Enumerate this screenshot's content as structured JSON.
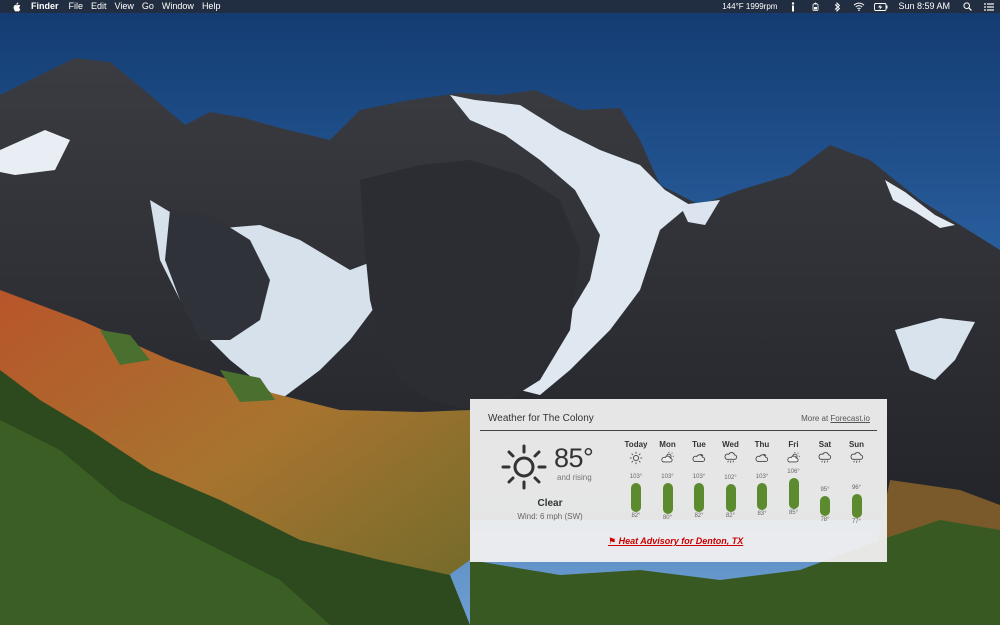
{
  "menubar": {
    "app_name": "Finder",
    "menus": [
      "File",
      "Edit",
      "View",
      "Go",
      "Window",
      "Help"
    ],
    "status_text": "144°F 1999rpm",
    "clock": "Sun 8:59 AM"
  },
  "widget": {
    "title": "Weather for The Colony",
    "more_prefix": "More at ",
    "more_link": "Forecast.io",
    "current": {
      "icon": "sun-icon",
      "temp": "85°",
      "trend": "and rising",
      "condition": "Clear",
      "wind": "Wind: 6 mph (SW)"
    },
    "forecast": [
      {
        "day": "Today",
        "icon": "sun-icon",
        "high": "103°",
        "low": "82°",
        "hi": 103,
        "lo": 82
      },
      {
        "day": "Mon",
        "icon": "partly-cloudy-icon",
        "high": "103°",
        "low": "80°",
        "hi": 103,
        "lo": 80
      },
      {
        "day": "Tue",
        "icon": "cloudy-icon",
        "high": "103°",
        "low": "82°",
        "hi": 103,
        "lo": 82
      },
      {
        "day": "Wed",
        "icon": "rain-icon",
        "high": "102°",
        "low": "82°",
        "hi": 102,
        "lo": 82
      },
      {
        "day": "Thu",
        "icon": "cloudy-icon",
        "high": "103°",
        "low": "83°",
        "hi": 103,
        "lo": 83
      },
      {
        "day": "Fri",
        "icon": "partly-cloudy-icon",
        "high": "106°",
        "low": "85°",
        "hi": 106,
        "lo": 85
      },
      {
        "day": "Sat",
        "icon": "rain-icon",
        "high": "95°",
        "low": "78°",
        "hi": 95,
        "lo": 78
      },
      {
        "day": "Sun",
        "icon": "rain-icon",
        "high": "96°",
        "low": "77°",
        "hi": 96,
        "lo": 77
      }
    ],
    "temp_scale": [
      70,
      110
    ],
    "advisory": "⚑ Heat Advisory for Denton, TX",
    "colors": {
      "bar": "#5c8a2e",
      "advisory": "#cc0000"
    }
  }
}
